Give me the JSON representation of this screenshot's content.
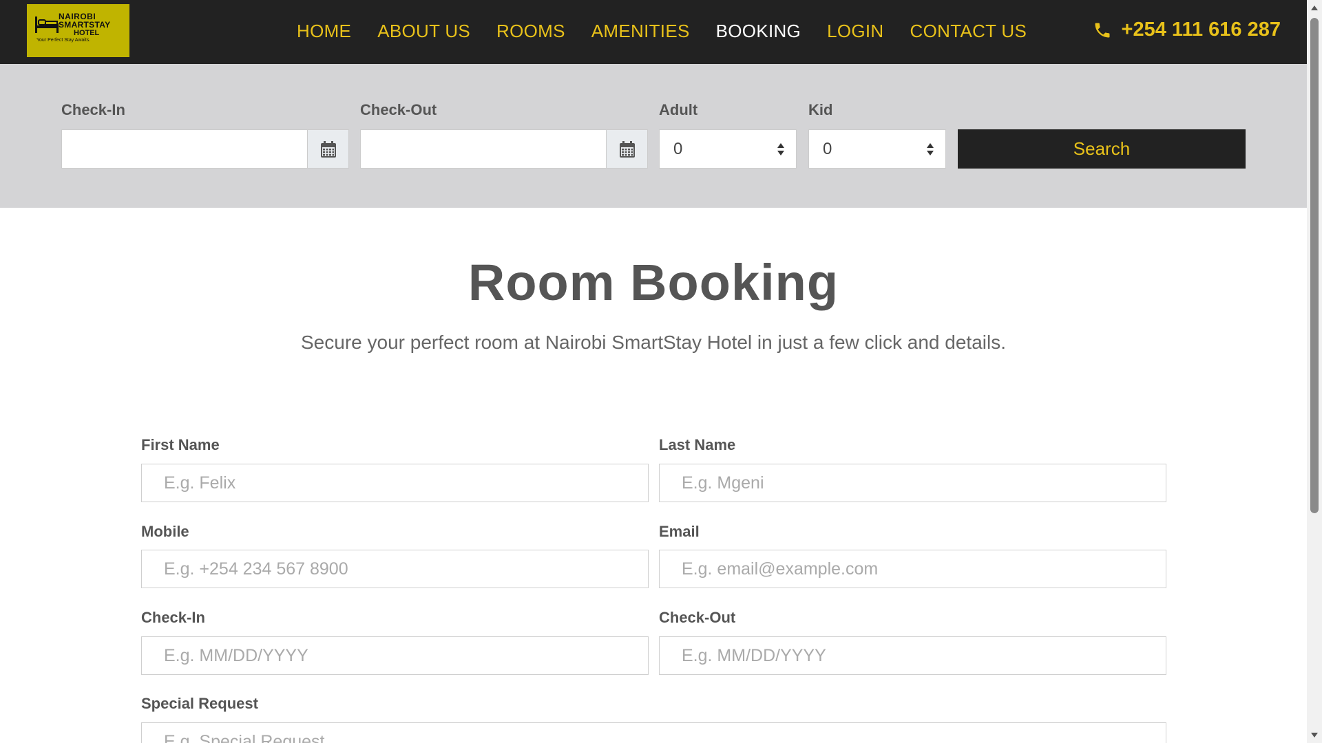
{
  "brand": {
    "logo_line1": "NAIROBI",
    "logo_line2": "SMARTSTAY",
    "logo_line3": "HOTEL",
    "logo_tagline": "Your Perfect Stay Awaits."
  },
  "nav": {
    "items": [
      {
        "label": "HOME"
      },
      {
        "label": "ABOUT US"
      },
      {
        "label": "ROOMS"
      },
      {
        "label": "AMENITIES"
      },
      {
        "label": "BOOKING"
      },
      {
        "label": "LOGIN"
      },
      {
        "label": "CONTACT US"
      }
    ],
    "active": "BOOKING"
  },
  "phone": {
    "icon": "phone-icon",
    "number": "+254 111 616 287"
  },
  "search_bar": {
    "checkin_label": "Check-In",
    "checkout_label": "Check-Out",
    "adult_label": "Adult",
    "adult_value": "0",
    "kid_label": "Kid",
    "kid_value": "0",
    "search_button": "Search"
  },
  "main": {
    "title": "Room Booking",
    "subtitle": "Secure your perfect room at Nairobi SmartStay Hotel in just a few click and details."
  },
  "form": {
    "first_name_label": "First Name",
    "first_name_placeholder": "E.g. Felix",
    "last_name_label": "Last Name",
    "last_name_placeholder": "E.g. Mgeni",
    "mobile_label": "Mobile",
    "mobile_placeholder": "E.g. +254 234 567 8900",
    "email_label": "Email",
    "email_placeholder": "E.g. email@example.com",
    "checkin_label": "Check-In",
    "checkin_placeholder": "E.g. MM/DD/YYYY",
    "checkout_label": "Check-Out",
    "checkout_placeholder": "E.g. MM/DD/YYYY",
    "special_request_label": "Special Request",
    "special_request_placeholder": "E.g. Special Request"
  },
  "colors": {
    "header_bg": "#222222",
    "accent": "#e8c11a",
    "logo_bg": "#c0b400",
    "searchbar_bg": "#d4d4d6"
  }
}
